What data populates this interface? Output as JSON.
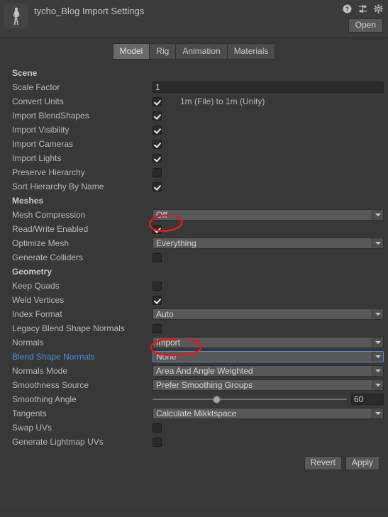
{
  "header": {
    "title": "tycho_Blog Import Settings",
    "open_label": "Open",
    "icons": [
      {
        "name": "help-icon",
        "glyph": "?"
      },
      {
        "name": "preset-icon",
        "glyph": "preset"
      },
      {
        "name": "gear-icon",
        "glyph": "gear"
      }
    ]
  },
  "tabs": [
    {
      "label": "Model",
      "active": true
    },
    {
      "label": "Rig",
      "active": false
    },
    {
      "label": "Animation",
      "active": false
    },
    {
      "label": "Materials",
      "active": false
    }
  ],
  "sections": [
    {
      "title": "Scene",
      "rows": [
        {
          "label": "Scale Factor",
          "type": "text",
          "value": "1"
        },
        {
          "label": "Convert Units",
          "type": "checkbox",
          "checked": true,
          "note": "1m (File) to 1m (Unity)"
        },
        {
          "label": "Import BlendShapes",
          "type": "checkbox",
          "checked": true
        },
        {
          "label": "Import Visibility",
          "type": "checkbox",
          "checked": true
        },
        {
          "label": "Import Cameras",
          "type": "checkbox",
          "checked": true
        },
        {
          "label": "Import Lights",
          "type": "checkbox",
          "checked": true
        },
        {
          "label": "Preserve Hierarchy",
          "type": "checkbox",
          "checked": false
        },
        {
          "label": "Sort Hierarchy By Name",
          "type": "checkbox",
          "checked": true
        }
      ]
    },
    {
      "title": "Meshes",
      "rows": [
        {
          "label": "Mesh Compression",
          "type": "dropdown",
          "value": "Off"
        },
        {
          "label": "Read/Write Enabled",
          "type": "checkbox",
          "checked": true,
          "annotated": true
        },
        {
          "label": "Optimize Mesh",
          "type": "dropdown",
          "value": "Everything"
        },
        {
          "label": "Generate Colliders",
          "type": "checkbox",
          "checked": false
        }
      ]
    },
    {
      "title": "Geometry",
      "rows": [
        {
          "label": "Keep Quads",
          "type": "checkbox",
          "checked": false
        },
        {
          "label": "Weld Vertices",
          "type": "checkbox",
          "checked": true
        },
        {
          "label": "Index Format",
          "type": "dropdown",
          "value": "Auto"
        },
        {
          "label": "Legacy Blend Shape Normals",
          "type": "checkbox",
          "checked": false
        },
        {
          "label": "Normals",
          "type": "dropdown",
          "value": "Import"
        },
        {
          "label": "Blend Shape Normals",
          "type": "dropdown",
          "value": "None",
          "highlight": true,
          "focused": true,
          "annotated": true
        },
        {
          "label": "Normals Mode",
          "type": "dropdown",
          "value": "Area And Angle Weighted"
        },
        {
          "label": "Smoothness Source",
          "type": "dropdown",
          "value": "Prefer Smoothing Groups"
        },
        {
          "label": "Smoothing Angle",
          "type": "slider",
          "value": "60"
        },
        {
          "label": "Tangents",
          "type": "dropdown",
          "value": "Calculate Mikktspace"
        },
        {
          "label": "Swap UVs",
          "type": "checkbox",
          "checked": false
        },
        {
          "label": "Generate Lightmap UVs",
          "type": "checkbox",
          "checked": false
        }
      ]
    }
  ],
  "footer": {
    "revert_label": "Revert",
    "apply_label": "Apply"
  },
  "colors": {
    "background": "#383838",
    "header": "#3c3c3c",
    "accent_blue": "#4b8fdb",
    "annotation_red": "#e01b1b",
    "text": "#b8b8b8"
  }
}
